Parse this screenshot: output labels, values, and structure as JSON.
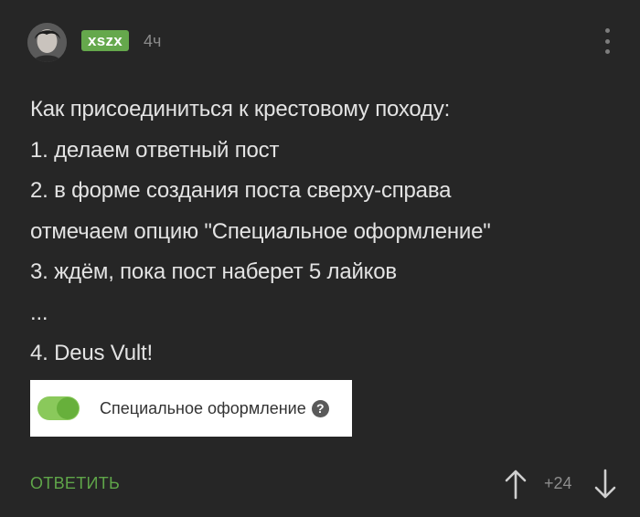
{
  "post": {
    "author": "xszx",
    "time": "4ч",
    "lines": [
      "Как присоединиться к крестовому походу:",
      "1. делаем ответный пост",
      "2. в форме создания поста сверху-справа",
      "отмечаем опцию \"Специальное оформление\"",
      "3. ждём, пока пост наберет 5 лайков",
      "...",
      "4. Deus Vult!"
    ]
  },
  "embed": {
    "toggle_state": "on",
    "label": "Специальное оформление",
    "help_symbol": "?"
  },
  "footer": {
    "reply_label": "ОТВЕТИТЬ",
    "rating": "+24"
  },
  "colors": {
    "background": "#262626",
    "accent_green": "#65a84c",
    "text": "#e3e3e3",
    "muted": "#8d8d8d"
  },
  "icons": {
    "menu": "more-vertical-icon",
    "vote_up": "arrow-up-icon",
    "vote_down": "arrow-down-icon",
    "help": "question-circle-icon"
  }
}
